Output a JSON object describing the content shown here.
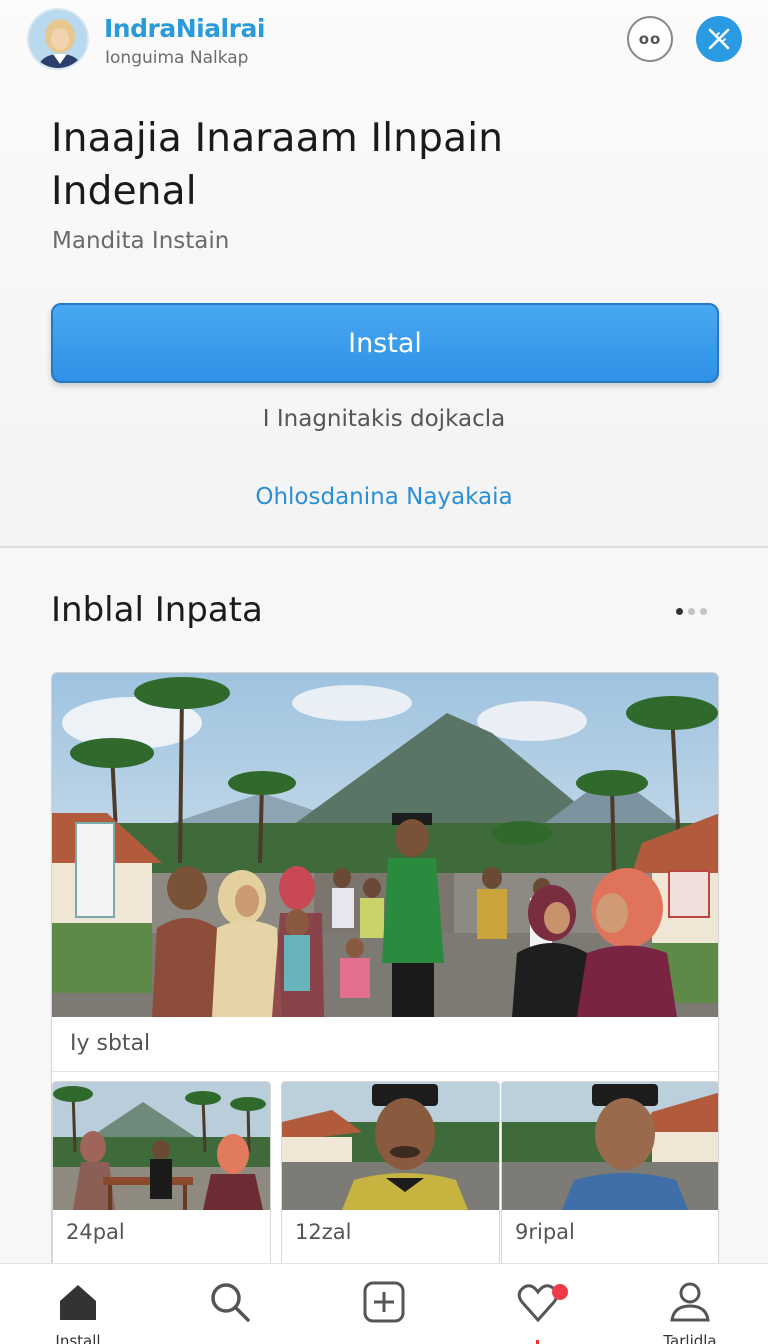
{
  "header": {
    "brand": "IndraNialrai",
    "brand_sub": "Ionguima Nalkap",
    "more_label": "oo"
  },
  "app": {
    "title": "Inaajia Inaraam Ilnpain Indenal",
    "subtitle": "Mandita Instain",
    "install_label": "Instal",
    "info_text": "I Inagnitakis dojkacla",
    "link_text": "Ohlosdanina Nayakaia"
  },
  "section": {
    "title": "Inblal Inpata",
    "pager_count": 3,
    "pager_active": 0,
    "hero_caption": "Iy sbtal",
    "thumbs": [
      {
        "caption": "24pal"
      },
      {
        "caption": "12zal"
      },
      {
        "caption": "9ripal"
      }
    ]
  },
  "nav": {
    "items": [
      {
        "label": "Install",
        "icon": "home-icon"
      },
      {
        "label": "",
        "icon": "search-icon"
      },
      {
        "label": "",
        "icon": "add-icon"
      },
      {
        "label": "",
        "icon": "heart-icon"
      },
      {
        "label": "Tarlidla",
        "icon": "profile-icon"
      }
    ]
  },
  "colors": {
    "accent": "#2f91e6",
    "brand": "#2a9bd8",
    "link": "#2a8fd4",
    "badge": "#ee3b4a"
  }
}
